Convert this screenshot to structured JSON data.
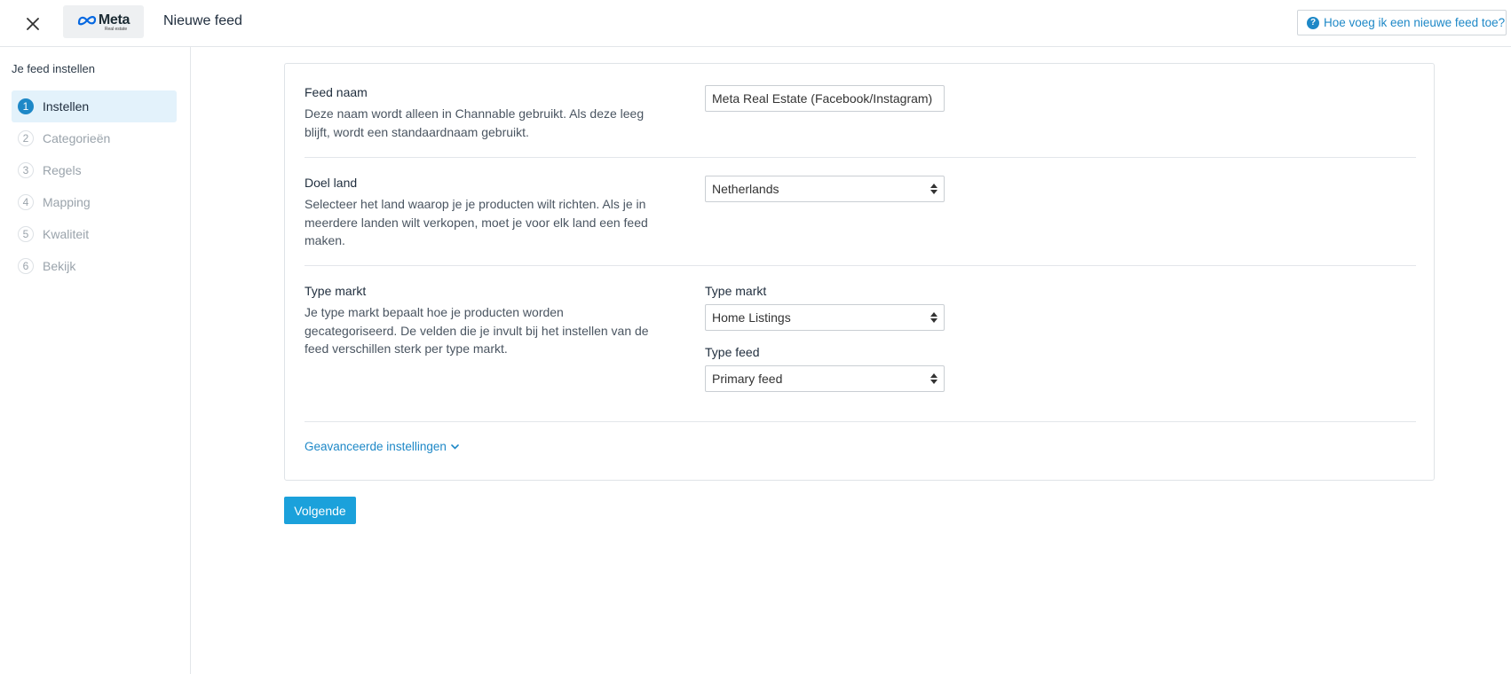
{
  "header": {
    "logo_word": "Meta",
    "logo_sub": "Real estate",
    "title": "Nieuwe feed",
    "help_label": "Hoe voeg ik een nieuwe feed toe?"
  },
  "sidebar": {
    "heading": "Je feed instellen",
    "steps": [
      {
        "num": "1",
        "label": "Instellen",
        "active": true
      },
      {
        "num": "2",
        "label": "Categorieën",
        "active": false
      },
      {
        "num": "3",
        "label": "Regels",
        "active": false
      },
      {
        "num": "4",
        "label": "Mapping",
        "active": false
      },
      {
        "num": "5",
        "label": "Kwaliteit",
        "active": false
      },
      {
        "num": "6",
        "label": "Bekijk",
        "active": false
      }
    ]
  },
  "form": {
    "feed_name": {
      "title": "Feed naam",
      "description": "Deze naam wordt alleen in Channable gebruikt. Als deze leeg blijft, wordt een standaardnaam gebruikt.",
      "value": "Meta Real Estate (Facebook/Instagram)"
    },
    "target_country": {
      "title": "Doel land",
      "description": "Selecteer het land waarop je je producten wilt richten. Als je in meerdere landen wilt verkopen, moet je voor elk land een feed maken.",
      "value": "Netherlands"
    },
    "market_type": {
      "title": "Type markt",
      "description": "Je type markt bepaalt hoe je producten worden gecategoriseerd. De velden die je invult bij het instellen van de feed verschillen sterk per type markt.",
      "market_label": "Type markt",
      "market_value": "Home Listings",
      "feed_label": "Type feed",
      "feed_value": "Primary feed"
    },
    "advanced_label": "Geavanceerde instellingen"
  },
  "next_button": "Volgende",
  "colors": {
    "accent": "#1e88c7",
    "button": "#1ba1db",
    "active_step_bg": "#e3f2fb"
  }
}
